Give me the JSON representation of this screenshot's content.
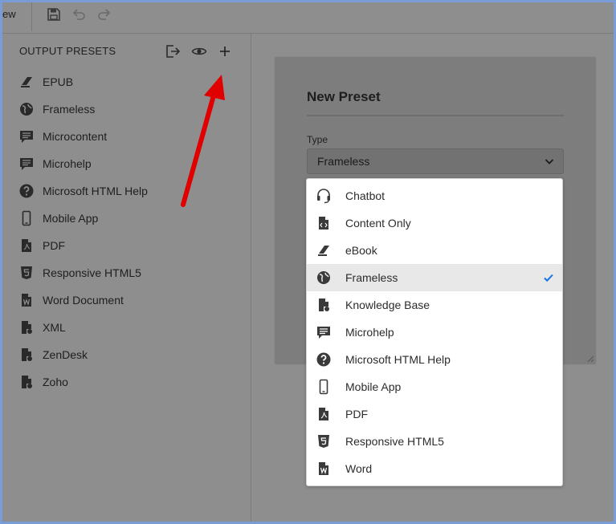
{
  "toolbar": {
    "partial_label": "ew",
    "save_icon": "save-icon",
    "undo_icon": "undo-icon",
    "redo_icon": "redo-icon"
  },
  "sidebar": {
    "title": "OUTPUT PRESETS",
    "actions": [
      {
        "icon": "export-icon"
      },
      {
        "icon": "preview-eye-icon"
      },
      {
        "icon": "plus-icon"
      }
    ],
    "items": [
      {
        "label": "EPUB",
        "icon": "ebook-icon"
      },
      {
        "label": "Frameless",
        "icon": "globe-icon"
      },
      {
        "label": "Microcontent",
        "icon": "microcontent-icon"
      },
      {
        "label": "Microhelp",
        "icon": "microhelp-icon"
      },
      {
        "label": "Microsoft HTML Help",
        "icon": "help-circle-icon"
      },
      {
        "label": "Mobile App",
        "icon": "mobile-icon"
      },
      {
        "label": "PDF",
        "icon": "pdf-icon"
      },
      {
        "label": "Responsive HTML5",
        "icon": "html5-icon"
      },
      {
        "label": "Word Document",
        "icon": "word-icon"
      },
      {
        "label": "XML",
        "icon": "xml-doc-icon"
      },
      {
        "label": "ZenDesk",
        "icon": "zendesk-doc-icon"
      },
      {
        "label": "Zoho",
        "icon": "zoho-doc-icon"
      }
    ]
  },
  "modal": {
    "title": "New Preset",
    "type_label": "Type",
    "type_value": "Frameless"
  },
  "dropdown": {
    "selected": "Frameless",
    "options": [
      {
        "label": "Chatbot",
        "icon": "headset-icon"
      },
      {
        "label": "Content Only",
        "icon": "content-only-icon"
      },
      {
        "label": "eBook",
        "icon": "ebook-icon"
      },
      {
        "label": "Frameless",
        "icon": "globe-icon"
      },
      {
        "label": "Knowledge Base",
        "icon": "knowledge-base-icon"
      },
      {
        "label": "Microhelp",
        "icon": "microhelp-icon"
      },
      {
        "label": "Microsoft HTML Help",
        "icon": "help-circle-icon"
      },
      {
        "label": "Mobile App",
        "icon": "mobile-icon"
      },
      {
        "label": "PDF",
        "icon": "pdf-icon"
      },
      {
        "label": "Responsive HTML5",
        "icon": "html5-icon"
      },
      {
        "label": "Word",
        "icon": "word-icon"
      }
    ]
  },
  "colors": {
    "overlay": "#8e8e8e",
    "arrow": "#e00000",
    "checkmark": "#1473e6",
    "outer_border": "#7a9cd6"
  }
}
